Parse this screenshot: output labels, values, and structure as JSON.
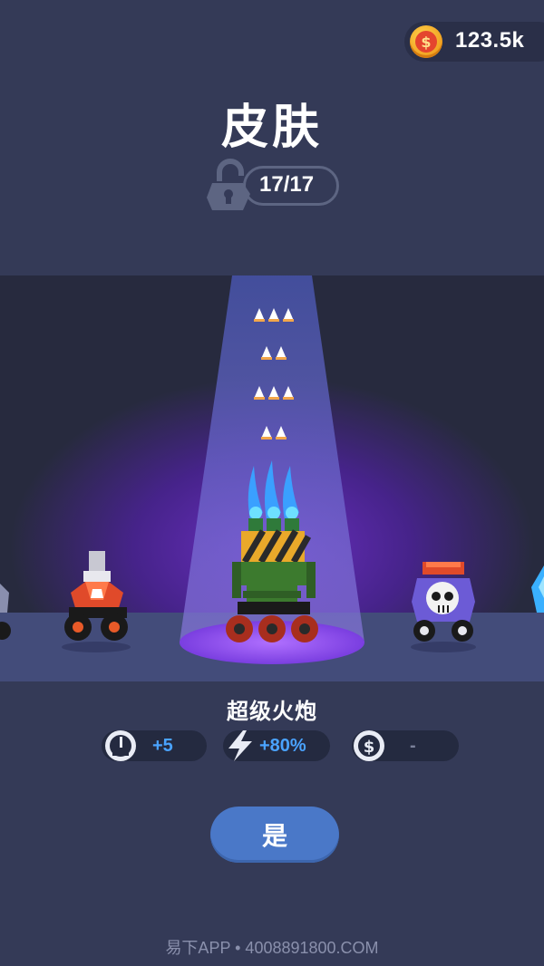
{
  "header": {
    "coins": "123.5k",
    "coin_symbol": "$",
    "title": "皮肤",
    "unlocked": "17/17"
  },
  "skin": {
    "name": "超级火炮",
    "stats": [
      {
        "icon": "speed-gauge-icon",
        "value": "+5"
      },
      {
        "icon": "lightning-icon",
        "value": "+80%"
      },
      {
        "icon": "dollar-coin-icon",
        "value": "-"
      }
    ]
  },
  "actions": {
    "confirm_label": "是"
  },
  "watermark": "易下APP • 4008891800.COM",
  "colors": {
    "background": "#343a57",
    "accent_button": "#4a78c8",
    "stat_text": "#4aa3ff",
    "stage_glow": "#6b2fc2"
  }
}
